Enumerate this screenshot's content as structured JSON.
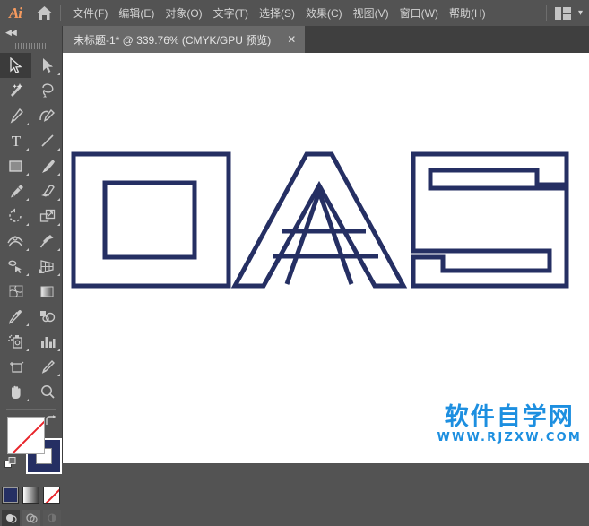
{
  "app": {
    "name": "Adobe Illustrator",
    "logo_text": "Ai",
    "home_icon": "home-icon",
    "workspace_icon": "workspace-layout-icon",
    "workspace_chevron": "chevron-down-icon"
  },
  "menubar": {
    "items": [
      {
        "label": "文件(F)",
        "name": "menu-file"
      },
      {
        "label": "编辑(E)",
        "name": "menu-edit"
      },
      {
        "label": "对象(O)",
        "name": "menu-object"
      },
      {
        "label": "文字(T)",
        "name": "menu-type"
      },
      {
        "label": "选择(S)",
        "name": "menu-select"
      },
      {
        "label": "效果(C)",
        "name": "menu-effect"
      },
      {
        "label": "视图(V)",
        "name": "menu-view"
      },
      {
        "label": "窗口(W)",
        "name": "menu-window"
      },
      {
        "label": "帮助(H)",
        "name": "menu-help"
      }
    ]
  },
  "tabbar": {
    "document_title": "未标题-1* @ 339.76% (CMYK/GPU 预览)",
    "close_label": "✕",
    "zoom_level": "339.76%",
    "color_mode": "CMYK",
    "renderer": "GPU",
    "preview_mode": "预览",
    "modified": true
  },
  "toolpanel": {
    "collapse_label": "◀◀",
    "tools": [
      {
        "name": "selection-tool",
        "icon": "arrow-solid-icon",
        "active": true,
        "flyout": false
      },
      {
        "name": "direct-selection-tool",
        "icon": "arrow-white-icon",
        "active": false,
        "flyout": true
      },
      {
        "name": "magic-wand-tool",
        "icon": "magic-wand-icon",
        "active": false,
        "flyout": false
      },
      {
        "name": "lasso-tool",
        "icon": "lasso-icon",
        "active": false,
        "flyout": false
      },
      {
        "name": "pen-tool",
        "icon": "pen-icon",
        "active": false,
        "flyout": true
      },
      {
        "name": "curvature-tool",
        "icon": "curvature-icon",
        "active": false,
        "flyout": false
      },
      {
        "name": "type-tool",
        "icon": "type-t-icon",
        "active": false,
        "flyout": true
      },
      {
        "name": "line-segment-tool",
        "icon": "line-icon",
        "active": false,
        "flyout": true
      },
      {
        "name": "rectangle-tool",
        "icon": "rectangle-icon",
        "active": false,
        "flyout": true
      },
      {
        "name": "paintbrush-tool",
        "icon": "paintbrush-icon",
        "active": false,
        "flyout": true
      },
      {
        "name": "shaper-pencil-tool",
        "icon": "pencil-icon",
        "active": false,
        "flyout": true
      },
      {
        "name": "eraser-tool",
        "icon": "eraser-icon",
        "active": false,
        "flyout": true
      },
      {
        "name": "rotate-tool",
        "icon": "rotate-icon",
        "active": false,
        "flyout": true
      },
      {
        "name": "scale-tool",
        "icon": "scale-icon",
        "active": false,
        "flyout": true
      },
      {
        "name": "width-tool",
        "icon": "width-warp-icon",
        "active": false,
        "flyout": true
      },
      {
        "name": "free-transform-tool",
        "icon": "pushpin-icon",
        "active": false,
        "flyout": true
      },
      {
        "name": "shape-builder-tool",
        "icon": "shape-builder-icon",
        "active": false,
        "flyout": true
      },
      {
        "name": "perspective-grid-tool",
        "icon": "perspective-grid-icon",
        "active": false,
        "flyout": true
      },
      {
        "name": "mesh-tool",
        "icon": "mesh-icon",
        "active": false,
        "flyout": false
      },
      {
        "name": "gradient-tool",
        "icon": "gradient-icon",
        "active": false,
        "flyout": false
      },
      {
        "name": "eyedropper-tool",
        "icon": "eyedropper-icon",
        "active": false,
        "flyout": true
      },
      {
        "name": "blend-tool",
        "icon": "blend-icon",
        "active": false,
        "flyout": false
      },
      {
        "name": "symbol-sprayer-tool",
        "icon": "symbol-sprayer-icon",
        "active": false,
        "flyout": true
      },
      {
        "name": "column-graph-tool",
        "icon": "bar-chart-icon",
        "active": false,
        "flyout": true
      },
      {
        "name": "artboard-tool",
        "icon": "artboard-icon",
        "active": false,
        "flyout": false
      },
      {
        "name": "slice-tool",
        "icon": "slice-knife-icon",
        "active": false,
        "flyout": true
      },
      {
        "name": "hand-tool",
        "icon": "hand-icon",
        "active": false,
        "flyout": true
      },
      {
        "name": "zoom-tool",
        "icon": "magnifier-icon",
        "active": false,
        "flyout": false
      }
    ],
    "fill": {
      "name": "fill-swatch",
      "value": "none",
      "color": "#ffffff"
    },
    "stroke": {
      "name": "stroke-swatch",
      "color": "#252f63"
    },
    "swap_icon": "swap-fill-stroke-icon",
    "default_icon": "default-fill-stroke-icon",
    "mode_buttons": [
      {
        "name": "color-button",
        "icon": "solid-color-icon",
        "color": "#252f63",
        "active": false
      },
      {
        "name": "gradient-button",
        "icon": "gradient-swatch-icon",
        "active": false
      },
      {
        "name": "none-button",
        "icon": "none-swatch-icon",
        "active": false
      }
    ],
    "draw_modes": [
      {
        "name": "draw-normal-button",
        "icon": "draw-normal-icon",
        "active": true
      },
      {
        "name": "draw-behind-button",
        "icon": "draw-behind-icon",
        "active": false
      },
      {
        "name": "draw-inside-button",
        "icon": "draw-inside-icon",
        "active": false
      }
    ]
  },
  "canvas": {
    "background": "#ffffff",
    "artwork": {
      "name": "oas-letter-outlines",
      "text": "OAS",
      "stroke_color": "#252f63",
      "fill": "none",
      "stroke_width": 5,
      "letters": [
        "O",
        "A",
        "S"
      ]
    },
    "watermark": {
      "chinese": "软件自学网",
      "url": "WWW.RJZXW.COM",
      "color": "#1d8fe0"
    }
  }
}
